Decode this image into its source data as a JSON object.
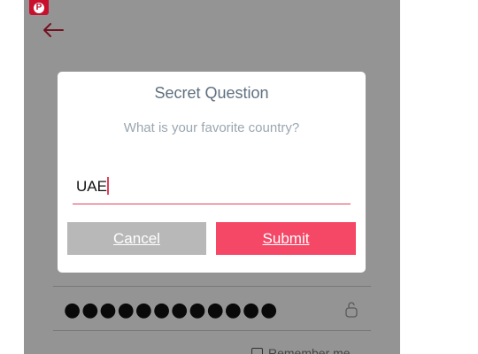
{
  "dialog": {
    "title": "Secret Question",
    "question": "What is your favorite country?",
    "answer_value": "UAE",
    "cancel_label": "Cancel",
    "submit_label": "Submit"
  },
  "login": {
    "password_masked": "●●●●●●●●●●●●",
    "remember_label": "Remember me"
  },
  "icons": {
    "badge": "pinterest-icon",
    "back": "arrow-left-icon",
    "lock": "lock-icon"
  },
  "colors": {
    "accent": "#f54766",
    "cancel": "#b8b8b8",
    "title": "#5f7080",
    "brand": "#c8102e"
  }
}
